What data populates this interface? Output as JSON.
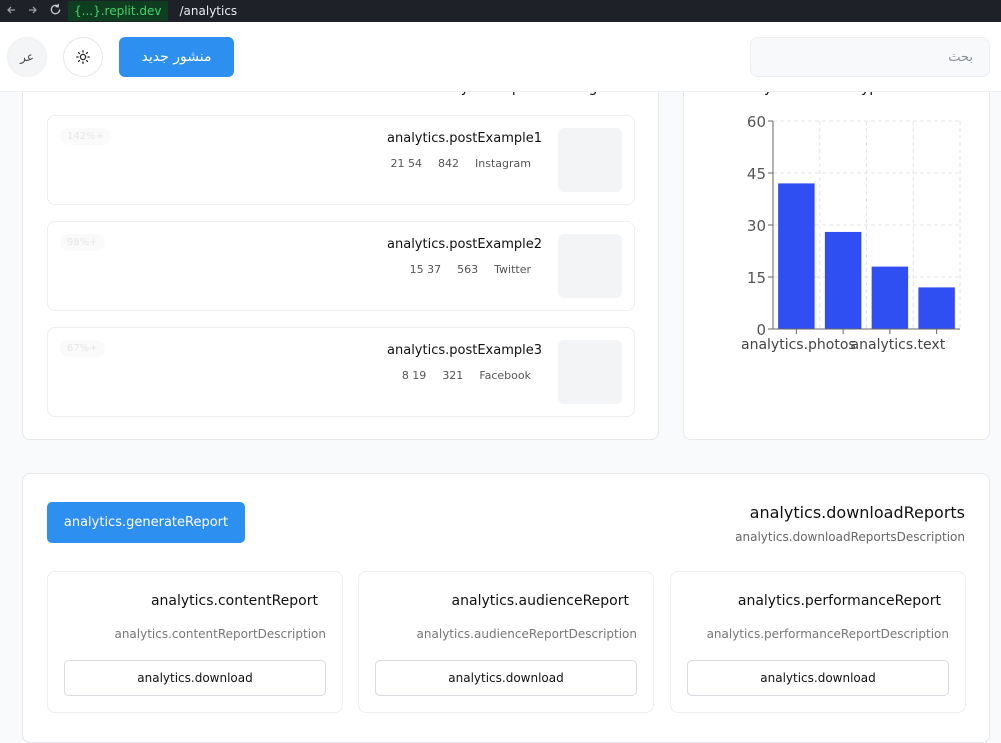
{
  "browser": {
    "back_icon": "back-arrow-icon",
    "forward_icon": "forward-arrow-icon",
    "reload_icon": "reload-icon",
    "host": "{...}.replit.dev",
    "path": "/analytics"
  },
  "header": {
    "search_placeholder": "بحث",
    "new_post_label": "منشور جديد",
    "theme_icon": "sun-icon",
    "language_label": "عر"
  },
  "top_posts": {
    "title": "analytics.topPerformingPosts",
    "posts": [
      {
        "title": "analytics.postExample1",
        "stat1": "21 54",
        "stat2": "842",
        "platform": "Instagram",
        "badge": "142%+"
      },
      {
        "title": "analytics.postExample2",
        "stat1": "15 37",
        "stat2": "563",
        "platform": "Twitter",
        "badge": "98%+"
      },
      {
        "title": "analytics.postExample3",
        "stat1": "8 19",
        "stat2": "321",
        "platform": "Facebook",
        "badge": "67%+"
      }
    ]
  },
  "content_breakdown": {
    "title": "analytics.contentTypeBreakdown"
  },
  "chart_data": {
    "type": "bar",
    "categories": [
      "analytics.photos",
      "",
      "analytics.text",
      ""
    ],
    "visible_tick_labels": [
      "analytics.photos",
      "analytics.text"
    ],
    "values": [
      42,
      28,
      18,
      12
    ],
    "ylim": [
      0,
      60
    ],
    "yticks": [
      0,
      15,
      30,
      45,
      60
    ],
    "grid": true,
    "color": "#2f4ff2"
  },
  "reports": {
    "title": "analytics.downloadReports",
    "description": "analytics.downloadReportsDescription",
    "generate_label": "analytics.generateReport",
    "items": [
      {
        "title": "analytics.performanceReport",
        "description": "analytics.performanceReportDescription",
        "download_label": "analytics.download"
      },
      {
        "title": "analytics.audienceReport",
        "description": "analytics.audienceReportDescription",
        "download_label": "analytics.download"
      },
      {
        "title": "analytics.contentReport",
        "description": "analytics.contentReportDescription",
        "download_label": "analytics.download"
      }
    ]
  },
  "colors": {
    "primary": "#2d8ff0",
    "chart_bar": "#2f4ff2",
    "url_host": "#46d36b"
  }
}
